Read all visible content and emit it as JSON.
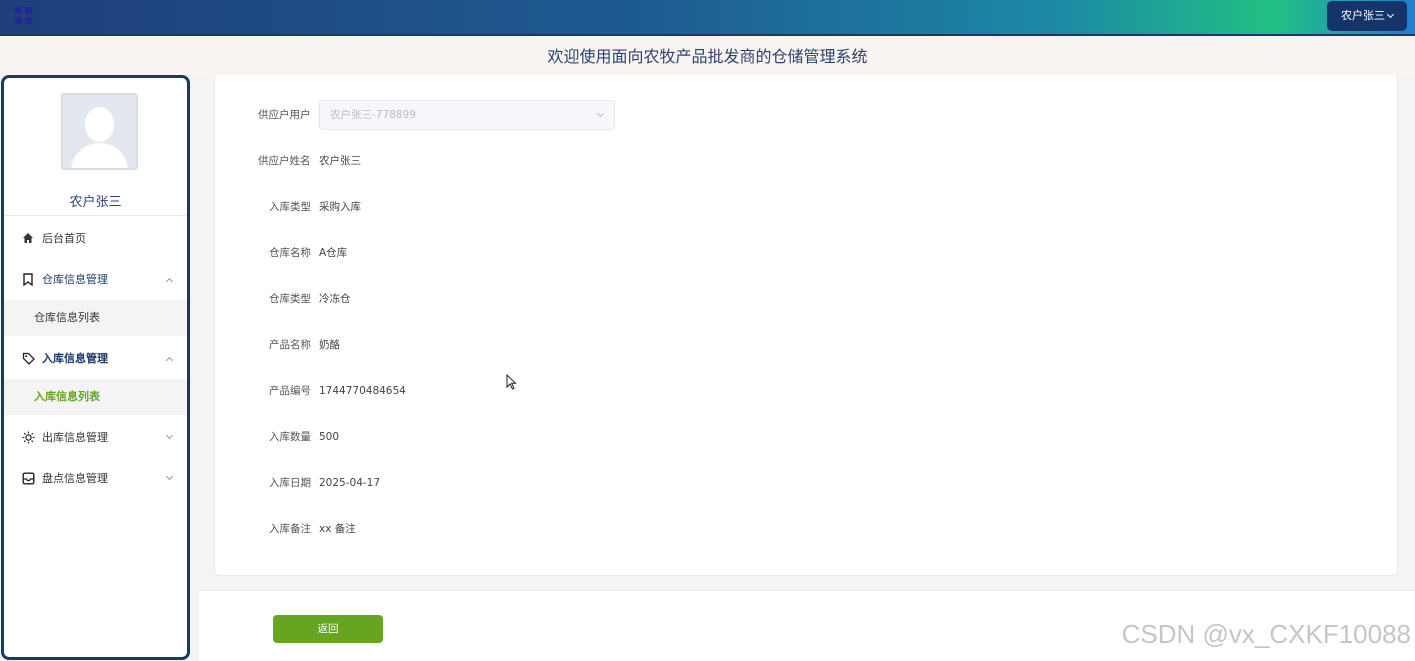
{
  "header": {
    "menu_icon": "grid-icon",
    "user_button_label": "农户张三"
  },
  "title_bar": {
    "title": "欢迎使用面向农牧产品批发商的仓储管理系统"
  },
  "sidebar": {
    "username": "农户张三",
    "menu": [
      {
        "label": "后台首页",
        "icon": "home-icon"
      },
      {
        "label": "仓库信息管理",
        "icon": "bookmark-icon",
        "expanded": true,
        "children": [
          "仓库信息列表"
        ]
      },
      {
        "label": "入库信息管理",
        "icon": "tag-icon",
        "expanded": true,
        "children": [
          "入库信息列表"
        ]
      },
      {
        "label": "出库信息管理",
        "icon": "sun-icon",
        "expanded": false
      },
      {
        "label": "盘点信息管理",
        "icon": "inbox-icon",
        "expanded": false
      }
    ]
  },
  "form": {
    "fields": [
      {
        "label": "供应户用户",
        "value": "农户张三-778899",
        "type": "select-disabled"
      },
      {
        "label": "供应户姓名",
        "value": "农户张三"
      },
      {
        "label": "入库类型",
        "value": "采购入库"
      },
      {
        "label": "仓库名称",
        "value": "A仓库"
      },
      {
        "label": "仓库类型",
        "value": "冷冻仓"
      },
      {
        "label": "产品名称",
        "value": "奶酪"
      },
      {
        "label": "产品编号",
        "value": "1744770484654"
      },
      {
        "label": "入库数量",
        "value": "500"
      },
      {
        "label": "入库日期",
        "value": "2025-04-17"
      },
      {
        "label": "入库备注",
        "value": "xx 备注"
      }
    ]
  },
  "actions": {
    "back_label": "返回"
  },
  "watermark": "CSDN @vx_CXKF10088",
  "colors": {
    "accent_green": "#67a420",
    "navy": "#173a6b"
  }
}
